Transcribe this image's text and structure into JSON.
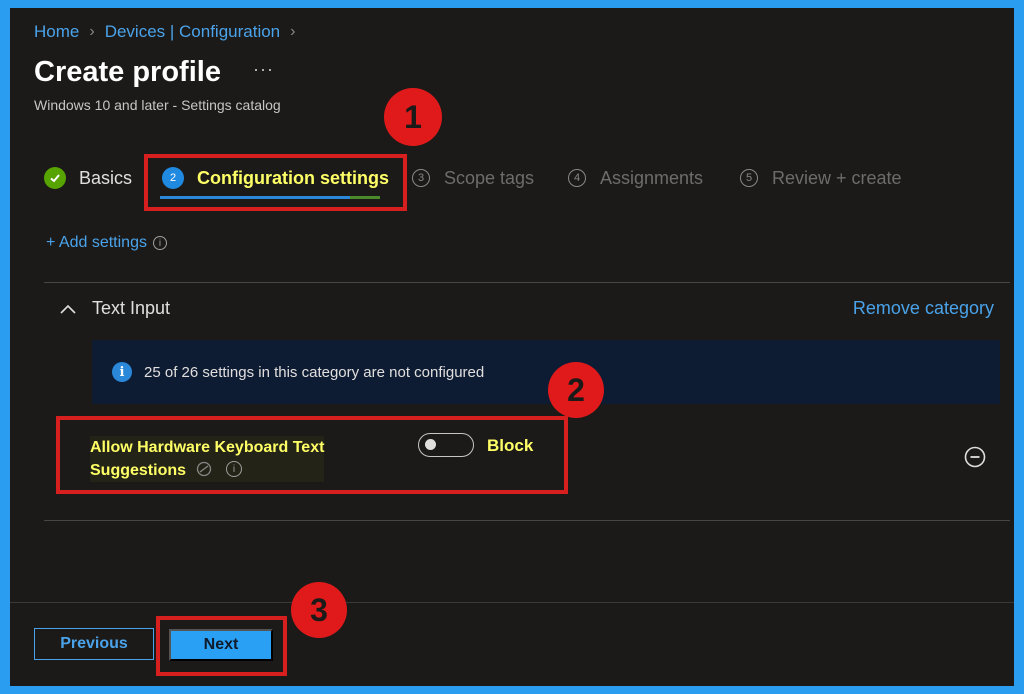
{
  "breadcrumb": {
    "home": "Home",
    "devices": "Devices | Configuration"
  },
  "header": {
    "title": "Create profile",
    "more": "···",
    "subtitle": "Windows 10 and later - Settings catalog"
  },
  "tabs": [
    {
      "label": "Basics",
      "status": "complete"
    },
    {
      "number": "2",
      "label": "Configuration settings",
      "status": "active"
    },
    {
      "number": "3",
      "label": "Scope tags"
    },
    {
      "number": "4",
      "label": "Assignments"
    },
    {
      "number": "5",
      "label": "Review + create"
    }
  ],
  "add_settings": "+ Add settings",
  "category": {
    "name": "Text Input",
    "remove_label": "Remove category",
    "info_banner": "25 of 26 settings in this category are not configured",
    "setting": {
      "name_line1": "Allow Hardware Keyboard Text",
      "name_line2": "Suggestions",
      "toggle_label": "Block",
      "toggle_on": false
    }
  },
  "footer": {
    "previous_label": "Previous",
    "next_label": "Next"
  },
  "annotations": {
    "badge1": "1",
    "badge2": "2",
    "badge3": "3"
  },
  "colors": {
    "accent": "#4aa3ea",
    "highlight": "#ffff66",
    "annotation": "#d81f1f",
    "frame": "#2b9df0"
  }
}
